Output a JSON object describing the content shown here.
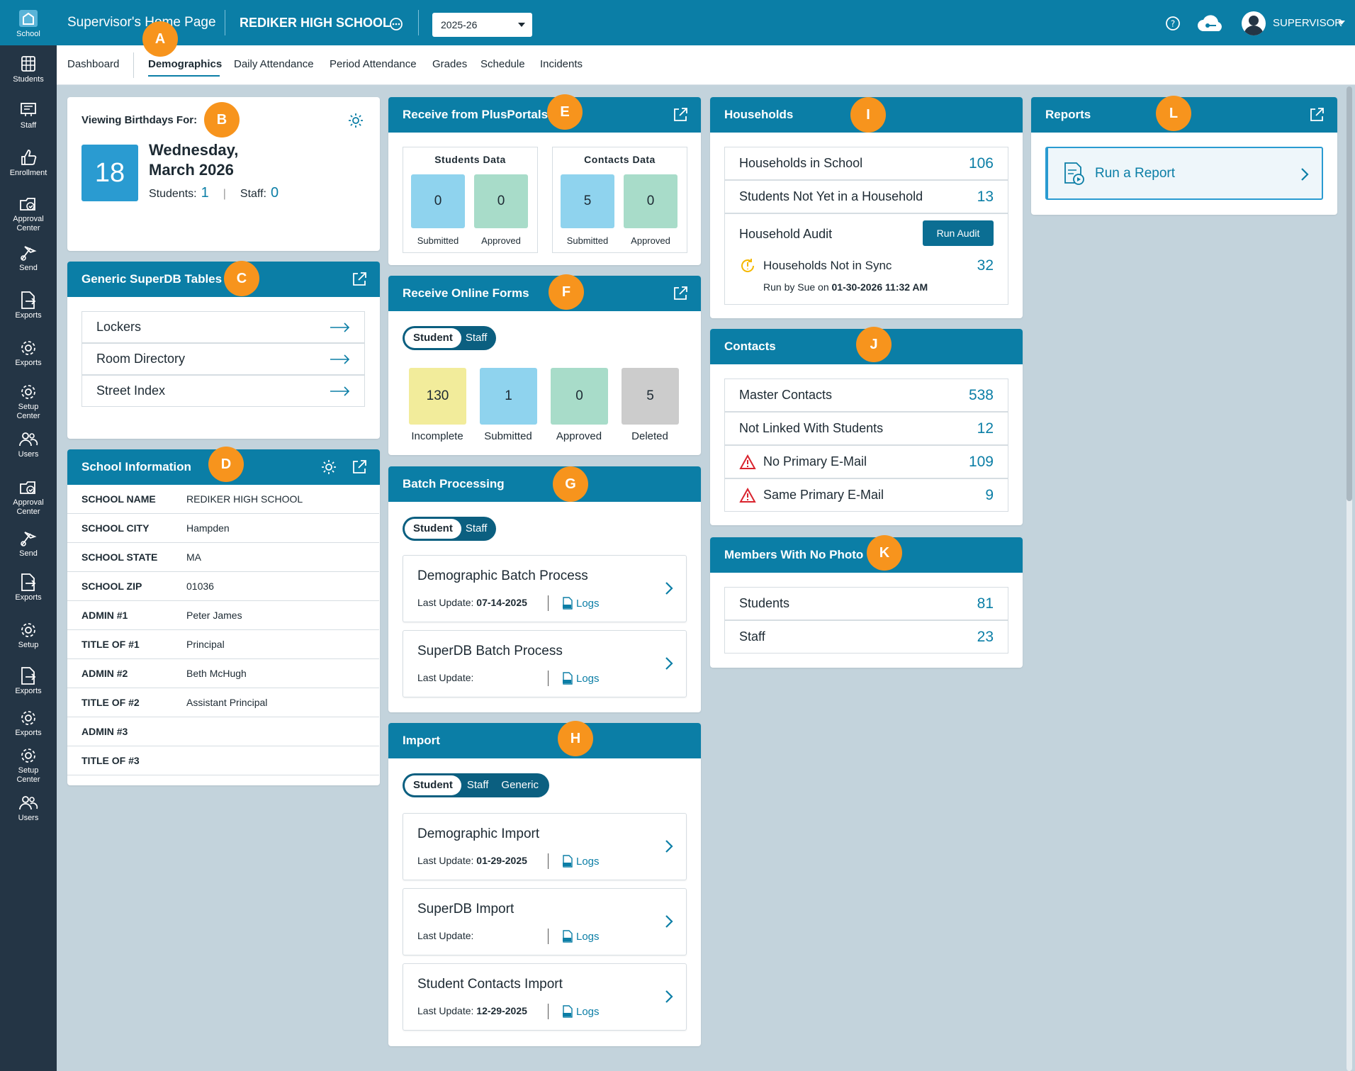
{
  "sidebar": {
    "items": [
      {
        "label": "School",
        "icon": "school-icon"
      },
      {
        "label": "Students",
        "icon": "students-icon"
      },
      {
        "label": "Staff",
        "icon": "staff-icon"
      },
      {
        "label": "Enrollment",
        "icon": "enrollment-icon"
      },
      {
        "label": "Approval Center",
        "icon": "approval-icon"
      },
      {
        "label": "Send",
        "icon": "send-icon"
      },
      {
        "label": "Exports",
        "icon": "exports-icon"
      },
      {
        "label": "Exports",
        "icon": "gear-icon"
      },
      {
        "label": "Setup Center",
        "icon": "gear-icon"
      },
      {
        "label": "Users",
        "icon": "users-icon"
      },
      {
        "label": "Approval Center",
        "icon": "approval-icon"
      },
      {
        "label": "Send",
        "icon": "send-icon"
      },
      {
        "label": "Exports",
        "icon": "exports-icon"
      },
      {
        "label": "Setup",
        "icon": "gear-icon"
      },
      {
        "label": "Exports",
        "icon": "exports-icon"
      },
      {
        "label": "Exports",
        "icon": "gear-icon"
      },
      {
        "label": "Setup Center",
        "icon": "gear-icon"
      },
      {
        "label": "Users",
        "icon": "users-icon"
      }
    ]
  },
  "header": {
    "page_title": "Supervisor's Home Page",
    "school": "REDIKER HIGH SCHOOL",
    "year": "2025-26",
    "user": "SUPERVISOR"
  },
  "tabs": [
    "Dashboard",
    "Demographics",
    "Daily Attendance",
    "Period Attendance",
    "Grades",
    "Schedule",
    "Incidents"
  ],
  "badges": [
    "A",
    "B",
    "C",
    "D",
    "E",
    "F",
    "G",
    "H",
    "I",
    "J",
    "K",
    "L"
  ],
  "birthdays": {
    "heading": "Viewing Birthdays For:",
    "day": "18",
    "weekday": "Wednesday,",
    "month_year": "March 2026",
    "students_label": "Students:",
    "students_count": "1",
    "staff_label": "Staff:",
    "staff_count": "0"
  },
  "superdb": {
    "title": "Generic SuperDB Tables",
    "items": [
      "Lockers",
      "Room Directory",
      "Street Index"
    ]
  },
  "school_info": {
    "title": "School Information",
    "rows": [
      {
        "k": "SCHOOL NAME",
        "v": "REDIKER HIGH SCHOOL"
      },
      {
        "k": "SCHOOL CITY",
        "v": "Hampden"
      },
      {
        "k": "SCHOOL STATE",
        "v": "MA"
      },
      {
        "k": "SCHOOL ZIP",
        "v": "01036"
      },
      {
        "k": "ADMIN #1",
        "v": "Peter James"
      },
      {
        "k": "TITLE OF #1",
        "v": "Principal"
      },
      {
        "k": "ADMIN #2",
        "v": "Beth McHugh"
      },
      {
        "k": "TITLE OF #2",
        "v": "Assistant Principal"
      },
      {
        "k": "ADMIN #3",
        "v": ""
      },
      {
        "k": "TITLE OF #3",
        "v": ""
      }
    ]
  },
  "pluspортals": {},
  "plusportals": {
    "title": "Receive from PlusPortals",
    "students_data": "Students Data",
    "contacts_data": "Contacts Data",
    "submitted": "Submitted",
    "approved": "Approved",
    "s_submitted": "0",
    "s_approved": "0",
    "c_submitted": "5",
    "c_approved": "0"
  },
  "online_forms": {
    "title": "Receive Online Forms",
    "toggle": [
      "Student",
      "Staff"
    ],
    "tiles": [
      {
        "value": "130",
        "label": "Incomplete",
        "color": "#f2ec9b"
      },
      {
        "value": "1",
        "label": "Submitted",
        "color": "#8fd3ee"
      },
      {
        "value": "0",
        "label": "Approved",
        "color": "#a8dcc9"
      },
      {
        "value": "5",
        "label": "Deleted",
        "color": "#cccccc"
      }
    ]
  },
  "batch": {
    "title": "Batch Processing",
    "toggle": [
      "Student",
      "Staff"
    ],
    "items": [
      {
        "title": "Demographic Batch Process",
        "last_label": "Last Update:",
        "last": "07-14-2025",
        "logs": "Logs"
      },
      {
        "title": "SuperDB Batch Process",
        "last_label": "Last Update:",
        "last": "",
        "logs": "Logs"
      }
    ]
  },
  "import": {
    "title": "Import",
    "toggle": [
      "Student",
      "Staff",
      "Generic"
    ],
    "items": [
      {
        "title": "Demographic Import",
        "last_label": "Last Update:",
        "last": "01-29-2025",
        "logs": "Logs"
      },
      {
        "title": "SuperDB Import",
        "last_label": "Last Update:",
        "last": "",
        "logs": "Logs"
      },
      {
        "title": "Student Contacts Import",
        "last_label": "Last Update:",
        "last": "12-29-2025",
        "logs": "Logs"
      }
    ]
  },
  "households": {
    "title": "Households",
    "rows": [
      {
        "label": "Households in School",
        "value": "106"
      },
      {
        "label": "Students Not Yet in a Household",
        "value": "13"
      }
    ],
    "audit_label": "Household Audit",
    "audit_button": "Run Audit",
    "sync_label": "Households Not in Sync",
    "sync_value": "32",
    "run_by": "Run by Sue on ",
    "run_date": "01-30-2026 11:32 AM"
  },
  "contacts": {
    "title": "Contacts",
    "rows": [
      {
        "label": "Master Contacts",
        "value": "538",
        "warn": false
      },
      {
        "label": "Not Linked With Students",
        "value": "12",
        "warn": false
      },
      {
        "label": "No Primary E-Mail",
        "value": "109",
        "warn": true
      },
      {
        "label": "Same Primary E-Mail",
        "value": "9",
        "warn": true
      }
    ]
  },
  "no_photo": {
    "title": "Members With No Photo",
    "rows": [
      {
        "label": "Students",
        "value": "81"
      },
      {
        "label": "Staff",
        "value": "23"
      }
    ]
  },
  "reports": {
    "title": "Reports",
    "run": "Run a Report"
  },
  "colors": {
    "primary": "#0b7ea6",
    "sidebar": "#243545",
    "badge": "#f7941d",
    "background": "#c3d3dc"
  }
}
